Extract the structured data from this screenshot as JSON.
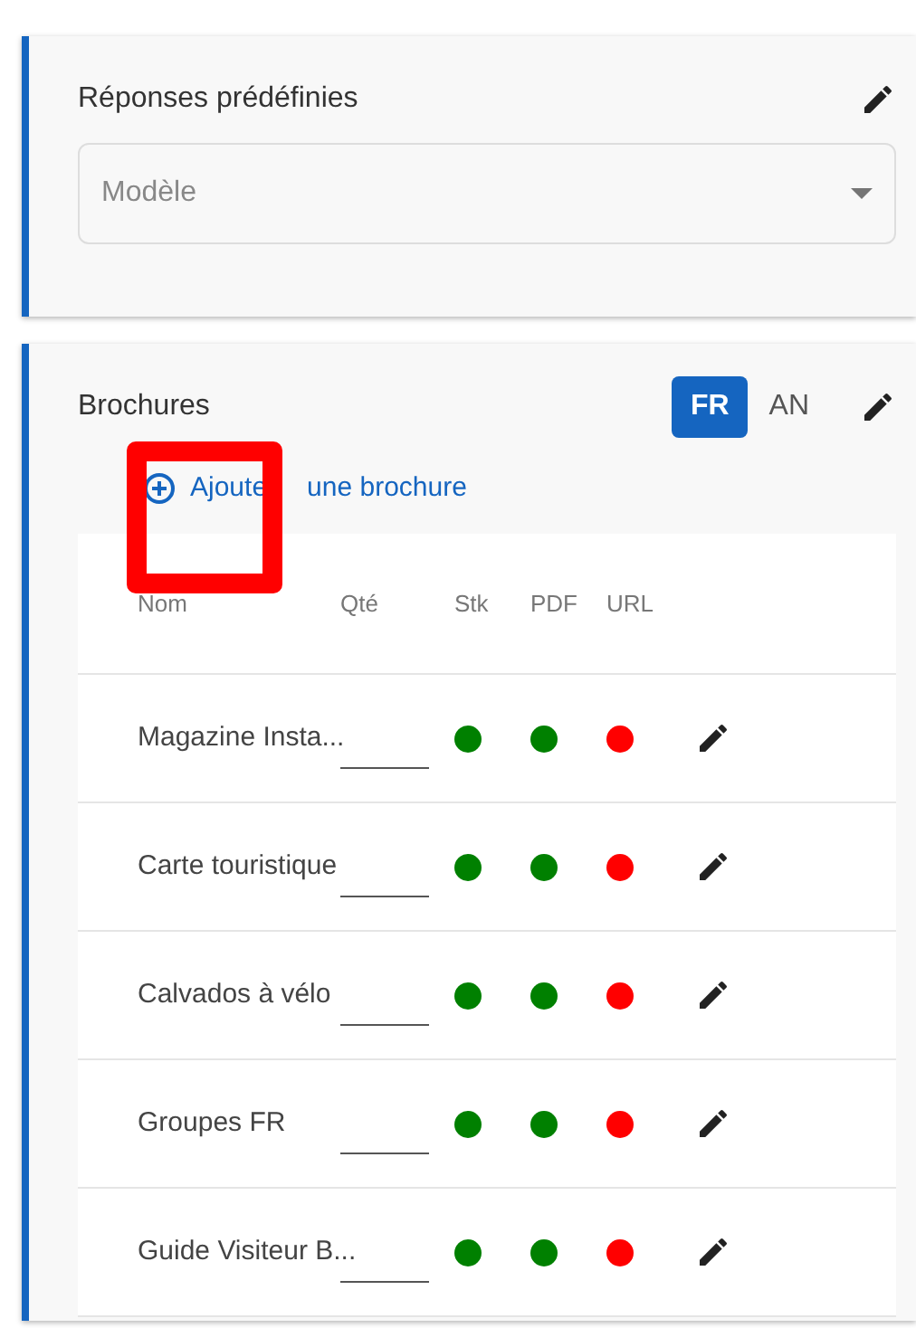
{
  "predefined_replies": {
    "title": "Réponses prédéfinies",
    "select": {
      "placeholder": "Modèle"
    }
  },
  "brochures": {
    "title": "Brochures",
    "languages": [
      {
        "label": "FR",
        "selected": true
      },
      {
        "label": "AN",
        "selected": false
      }
    ],
    "add_link": {
      "label_parts": [
        "Ajoute",
        "une brochure"
      ]
    },
    "table": {
      "columns": [
        "Nom",
        "Qté",
        "Stk",
        "PDF",
        "URL"
      ],
      "rows": [
        {
          "name": "Magazine Insta...",
          "statuses": [
            {
              "color": "#008000"
            },
            {
              "color": "#008000"
            },
            {
              "color": "#ff0000"
            }
          ]
        },
        {
          "name": "Carte touristique",
          "statuses": [
            {
              "color": "#008000"
            },
            {
              "color": "#008000"
            },
            {
              "color": "#ff0000"
            }
          ]
        },
        {
          "name": "Calvados à vélo",
          "statuses": [
            {
              "color": "#008000"
            },
            {
              "color": "#008000"
            },
            {
              "color": "#ff0000"
            }
          ]
        },
        {
          "name": "Groupes FR",
          "statuses": [
            {
              "color": "#008000"
            },
            {
              "color": "#008000"
            },
            {
              "color": "#ff0000"
            }
          ]
        },
        {
          "name": "Guide Visiteur B...",
          "statuses": [
            {
              "color": "#008000"
            },
            {
              "color": "#008000"
            },
            {
              "color": "#ff0000"
            }
          ]
        }
      ]
    }
  }
}
